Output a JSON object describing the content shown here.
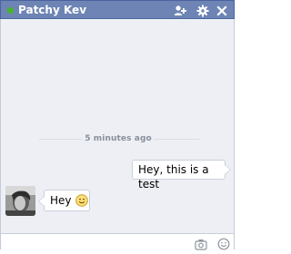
{
  "header": {
    "name": "Patchy Kev",
    "status": "online"
  },
  "conversation": {
    "timestamp": "5 minutes ago",
    "messages": [
      {
        "from": "me",
        "text": "Hey, this is a test"
      },
      {
        "from": "Patchy Kev",
        "text": "Hey",
        "emoji": "smiley-icon"
      }
    ]
  },
  "composer": {
    "input_value": "",
    "placeholder": ""
  },
  "colors": {
    "header_bg": "#6d84b4",
    "convo_bg": "#edeff4",
    "online": "#42b72a"
  }
}
